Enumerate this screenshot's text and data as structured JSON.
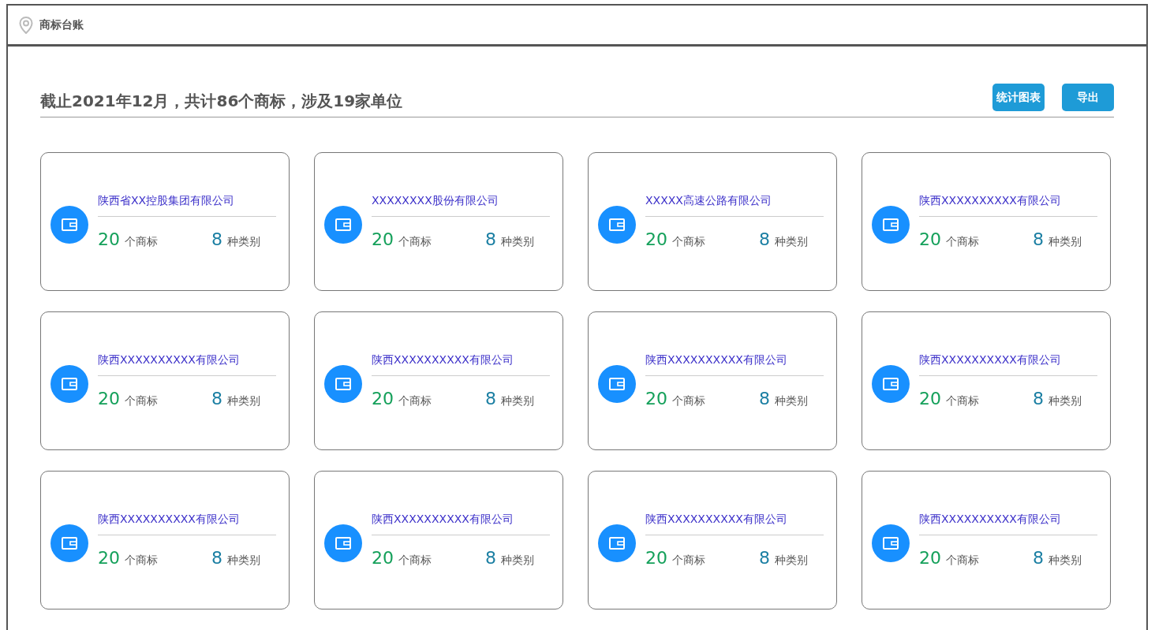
{
  "header": {
    "title": "商标台账"
  },
  "summary": {
    "text": "截止2021年12月，共计86个商标，涉及19家单位"
  },
  "buttons": [
    "统计图表",
    "导出"
  ],
  "companies": [
    {
      "name": "陕西省XX控股集团有限公司",
      "trademarks": "20",
      "trademarks_unit": "个商标",
      "categories": "8",
      "categories_unit": "种类别"
    },
    {
      "name": "XXXXXXXX股份有限公司",
      "trademarks": "20",
      "trademarks_unit": "个商标",
      "categories": "8",
      "categories_unit": "种类别"
    },
    {
      "name": "XXXXX高速公路有限公司",
      "trademarks": "20",
      "trademarks_unit": "个商标",
      "categories": "8",
      "categories_unit": "种类别"
    },
    {
      "name": "陕西XXXXXXXXXX有限公司",
      "trademarks": "20",
      "trademarks_unit": "个商标",
      "categories": "8",
      "categories_unit": "种类别"
    },
    {
      "name": "陕西XXXXXXXXXX有限公司",
      "trademarks": "20",
      "trademarks_unit": "个商标",
      "categories": "8",
      "categories_unit": "种类别"
    },
    {
      "name": "陕西XXXXXXXXXX有限公司",
      "trademarks": "20",
      "trademarks_unit": "个商标",
      "categories": "8",
      "categories_unit": "种类别"
    },
    {
      "name": "陕西XXXXXXXXXX有限公司",
      "trademarks": "20",
      "trademarks_unit": "个商标",
      "categories": "8",
      "categories_unit": "种类别"
    },
    {
      "name": "陕西XXXXXXXXXX有限公司",
      "trademarks": "20",
      "trademarks_unit": "个商标",
      "categories": "8",
      "categories_unit": "种类别"
    },
    {
      "name": "陕西XXXXXXXXXX有限公司",
      "trademarks": "20",
      "trademarks_unit": "个商标",
      "categories": "8",
      "categories_unit": "种类别"
    },
    {
      "name": "陕西XXXXXXXXXX有限公司",
      "trademarks": "20",
      "trademarks_unit": "个商标",
      "categories": "8",
      "categories_unit": "种类别"
    },
    {
      "name": "陕西XXXXXXXXXX有限公司",
      "trademarks": "20",
      "trademarks_unit": "个商标",
      "categories": "8",
      "categories_unit": "种类别"
    },
    {
      "name": "陕西XXXXXXXXXX有限公司",
      "trademarks": "20",
      "trademarks_unit": "个商标",
      "categories": "8",
      "categories_unit": "种类别"
    }
  ]
}
